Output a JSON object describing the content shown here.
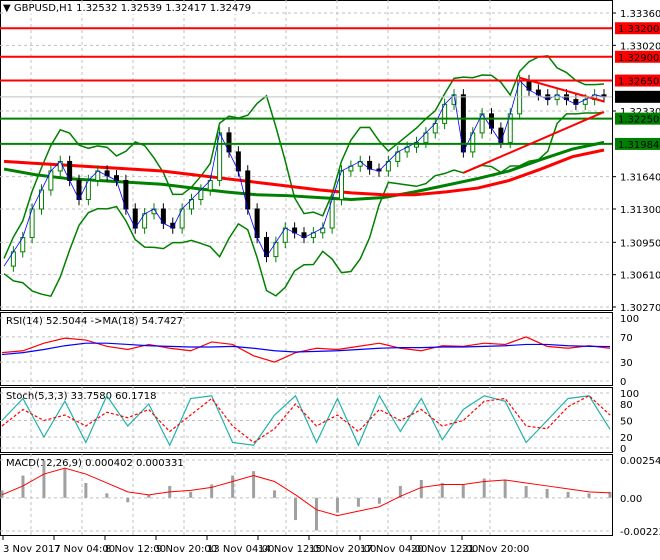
{
  "header": {
    "symbol": "GBPUSD,H1",
    "ohlc": "1.32532 1.32539 1.32417 1.32479"
  },
  "colors": {
    "bull": "#008000",
    "bear": "#ff0000",
    "ma_fast": "#ff0000",
    "ma_slow": "#008000",
    "bands": "#008000",
    "rsi": "#ff0000",
    "rsi_ma": "#0000ff",
    "stoch_main": "#20b2aa",
    "stoch_signal": "#ff0000",
    "macd_hist": "#a0a0a0",
    "macd_signal": "#ff0000"
  },
  "chart_data": [
    {
      "type": "line",
      "title": "GBPUSD,H1",
      "ylim": [
        1.3012,
        1.3362
      ],
      "y_ticks": [
        "1.33360",
        "1.33020",
        "1.32330",
        "1.31640",
        "1.31300",
        "1.30950",
        "1.30610",
        "1.30270"
      ],
      "current_price": "1.32479",
      "levels": [
        {
          "value": 1.332,
          "label": "1.33200",
          "color": "#ff0000"
        },
        {
          "value": 1.329,
          "label": "1.32900",
          "color": "#ff0000"
        },
        {
          "value": 1.3265,
          "label": "1.32650",
          "color": "#ff0000"
        },
        {
          "value": 1.3225,
          "label": "1.32250",
          "color": "#008000"
        },
        {
          "value": 1.31984,
          "label": "1.31984",
          "color": "#008000"
        }
      ],
      "close": [
        1.307,
        1.3085,
        1.31,
        1.313,
        1.315,
        1.317,
        1.318,
        1.316,
        1.314,
        1.316,
        1.317,
        1.3165,
        1.316,
        1.313,
        1.311,
        1.3125,
        1.313,
        1.3115,
        1.311,
        1.313,
        1.314,
        1.315,
        1.316,
        1.321,
        1.319,
        1.317,
        1.313,
        1.31,
        1.308,
        1.3095,
        1.311,
        1.3105,
        1.31,
        1.3105,
        1.311,
        1.314,
        1.317,
        1.3175,
        1.318,
        1.3172,
        1.317,
        1.318,
        1.319,
        1.3195,
        1.32,
        1.321,
        1.322,
        1.324,
        1.325,
        1.319,
        1.321,
        1.323,
        1.3215,
        1.32,
        1.323,
        1.3265,
        1.3255,
        1.325,
        1.3245,
        1.325,
        1.3245,
        1.324,
        1.3245,
        1.325,
        1.3248
      ],
      "ma_fast": [
        1.318,
        1.3178,
        1.3176,
        1.3174,
        1.3172,
        1.317,
        1.3166,
        1.3162,
        1.3158,
        1.3154,
        1.315,
        1.3147,
        1.3145,
        1.3145,
        1.3148,
        1.3152,
        1.316,
        1.3172,
        1.3185,
        1.3192
      ],
      "ma_slow": [
        1.3172,
        1.3166,
        1.3162,
        1.316,
        1.3158,
        1.3156,
        1.3152,
        1.3148,
        1.3145,
        1.3144,
        1.3142,
        1.314,
        1.3142,
        1.3148,
        1.3155,
        1.3162,
        1.317,
        1.3182,
        1.3193,
        1.32
      ],
      "trendlines": [
        {
          "from": [
            55,
            1.3268
          ],
          "to": [
            64,
            1.3243
          ],
          "color": "#ff0000"
        },
        {
          "from": [
            49,
            1.3168
          ],
          "to": [
            64,
            1.3232
          ],
          "color": "#ff0000"
        }
      ]
    },
    {
      "type": "line",
      "title": "RSI(14) 52.5044  ->MA(18) 54.7427",
      "ylim": [
        0,
        100
      ],
      "y_ticks": [
        "100",
        "70",
        "30",
        "0"
      ],
      "series": [
        {
          "name": "RSI(14)",
          "values": [
            45,
            48,
            60,
            68,
            65,
            55,
            50,
            58,
            52,
            48,
            62,
            58,
            40,
            30,
            45,
            52,
            50,
            55,
            60,
            52,
            48,
            56,
            55,
            60,
            58,
            70,
            55,
            52,
            56,
            52
          ]
        },
        {
          "name": "MA(18)",
          "values": [
            42,
            45,
            50,
            56,
            60,
            60,
            58,
            56,
            55,
            54,
            54,
            55,
            52,
            48,
            46,
            47,
            48,
            50,
            52,
            53,
            53,
            54,
            54,
            55,
            56,
            58,
            58,
            56,
            55,
            54.7
          ]
        }
      ]
    },
    {
      "type": "line",
      "title": "Stoch(5,3,3) 33.7580 60.1718",
      "ylim": [
        0,
        100
      ],
      "y_ticks": [
        "100",
        "80",
        "50",
        "20",
        "0"
      ],
      "series": [
        {
          "name": "Main",
          "values": [
            50,
            90,
            20,
            85,
            10,
            95,
            40,
            80,
            5,
            90,
            95,
            10,
            5,
            60,
            95,
            10,
            90,
            5,
            95,
            30,
            90,
            15,
            70,
            95,
            85,
            10,
            50,
            90,
            95,
            34
          ]
        },
        {
          "name": "Signal",
          "values": [
            40,
            70,
            50,
            60,
            40,
            65,
            55,
            70,
            30,
            60,
            90,
            40,
            10,
            35,
            80,
            40,
            60,
            30,
            70,
            50,
            70,
            40,
            50,
            85,
            90,
            40,
            35,
            75,
            95,
            60
          ]
        }
      ]
    },
    {
      "type": "bar",
      "title": "MACD(12,26,9) 0.000402 0.000331",
      "ylim": [
        -0.002236,
        0.002548
      ],
      "y_ticks": [
        "0.002548",
        "0.00",
        "-0.002236"
      ],
      "series": [
        {
          "name": "MACD",
          "values": [
            0.0005,
            0.0015,
            0.0025,
            0.002,
            0.001,
            0.0003,
            -0.0003,
            0.0002,
            0.0008,
            0.0004,
            0.0009,
            0.0015,
            0.0018,
            0.0005,
            -0.0015,
            -0.0022,
            -0.001,
            -0.0006,
            -0.0004,
            0.0008,
            0.0012,
            0.001,
            0.0009,
            0.0013,
            0.0012,
            0.0008,
            0.0006,
            0.0004,
            0.0003,
            0.0004
          ]
        },
        {
          "name": "Signal",
          "values": [
            0.0002,
            0.0008,
            0.0016,
            0.002,
            0.0016,
            0.001,
            0.0004,
            0.0002,
            0.0004,
            0.0005,
            0.0007,
            0.0011,
            0.0015,
            0.0011,
            0.0002,
            -0.0008,
            -0.0012,
            -0.0009,
            -0.0006,
            0.0001,
            0.0007,
            0.0009,
            0.0009,
            0.0011,
            0.0012,
            0.001,
            0.0008,
            0.0006,
            0.0004,
            0.00033
          ]
        }
      ]
    }
  ],
  "x_ticks": [
    "3 Nov 2017",
    "7 Nov 04:00",
    "8 Nov 12:00",
    "9 Nov 20:00",
    "13 Nov 04:00",
    "14 Nov 12:00",
    "15 Nov 20:00",
    "17 Nov 04:00",
    "20 Nov 12:00",
    "21 Nov 20:00"
  ]
}
